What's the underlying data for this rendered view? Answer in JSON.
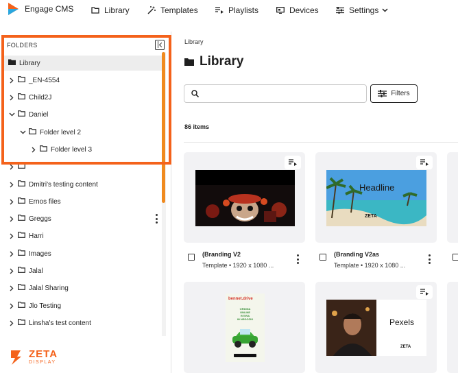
{
  "app": {
    "name": "Engage CMS"
  },
  "nav": {
    "library": "Library",
    "templates": "Templates",
    "playlists": "Playlists",
    "devices": "Devices",
    "settings": "Settings"
  },
  "sidebar": {
    "header": "FOLDERS",
    "items": [
      {
        "label": "Library",
        "level": 0,
        "expander": "none",
        "active": true
      },
      {
        "label": "_EN-4554",
        "level": 0,
        "expander": "right"
      },
      {
        "label": "Child2J",
        "level": 0,
        "expander": "right"
      },
      {
        "label": "Daniel",
        "level": 0,
        "expander": "down"
      },
      {
        "label": "Folder level 2",
        "level": 1,
        "expander": "down"
      },
      {
        "label": "Folder level 3",
        "level": 2,
        "expander": "right"
      },
      {
        "label": "",
        "level": 0,
        "expander": "right"
      },
      {
        "label": "Dmitri's testing content",
        "level": 0,
        "expander": "right"
      },
      {
        "label": "Ernos files",
        "level": 0,
        "expander": "right"
      },
      {
        "label": "Greggs",
        "level": 0,
        "expander": "right",
        "menu": true
      },
      {
        "label": "Harri",
        "level": 0,
        "expander": "right"
      },
      {
        "label": "Images",
        "level": 0,
        "expander": "right"
      },
      {
        "label": "Jalal",
        "level": 0,
        "expander": "right"
      },
      {
        "label": "Jalal Sharing",
        "level": 0,
        "expander": "right"
      },
      {
        "label": "Jlo Testing",
        "level": 0,
        "expander": "right"
      },
      {
        "label": "Linsha's test content",
        "level": 0,
        "expander": "right"
      }
    ],
    "footer_logo": {
      "brand": "ZETA",
      "sub": "DISPLAY"
    }
  },
  "main": {
    "breadcrumb": "Library",
    "title": "Library",
    "search": {
      "value": "",
      "placeholder": ""
    },
    "filters_label": "Filters",
    "items_count": "86 items",
    "cards": [
      {
        "name": "(Branding V2",
        "meta": "Template • 1920 x 1080 ...",
        "thumb": "anime-poster"
      },
      {
        "name": "(Branding V2as",
        "meta": "Template • 1920 x 1080 ...",
        "thumb": "beach-headline",
        "headline": "Headline",
        "logo": "ZETA"
      },
      {
        "name": "",
        "meta": "",
        "thumb": "promo-poster",
        "promo_brand": "bennet.drive",
        "promo_lines": [
          "ORDINA",
          "ONLINE",
          "RITIRA",
          "IN NEGOZIO"
        ]
      },
      {
        "name": "",
        "meta": "",
        "thumb": "pexels-portrait",
        "caption": "Pexels",
        "logo": "ZETA"
      }
    ]
  },
  "colors": {
    "accent": "#f4621b",
    "scrollbar": "#f08a1f",
    "active_row": "#ededed"
  }
}
